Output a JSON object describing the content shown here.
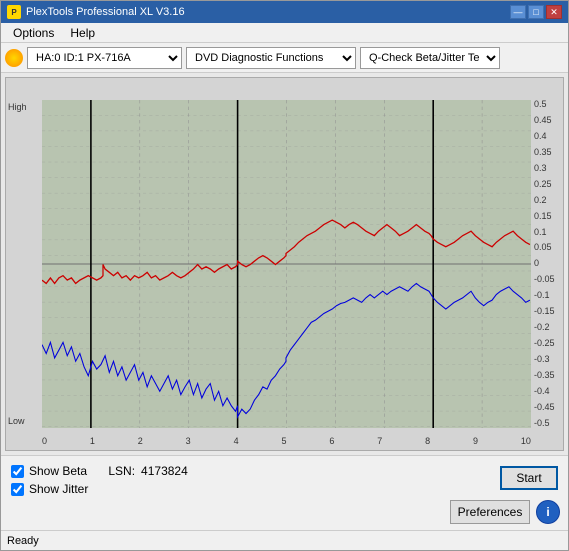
{
  "window": {
    "title": "PlexTools Professional XL V3.16",
    "icon": "P"
  },
  "titleButtons": {
    "minimize": "—",
    "maximize": "□",
    "close": "✕"
  },
  "menu": {
    "items": [
      "Options",
      "Help"
    ]
  },
  "toolbar": {
    "driveLabel": "HA:0 ID:1  PX-716A",
    "functionLabel": "DVD Diagnostic Functions",
    "testLabel": "Q-Check Beta/Jitter Test"
  },
  "chartLabels": {
    "high": "High",
    "low": "Low",
    "yLeftLabels": [],
    "yRightLabels": [
      "0.5",
      "0.45",
      "0.4",
      "0.35",
      "0.3",
      "0.25",
      "0.2",
      "0.15",
      "0.1",
      "0.05",
      "0",
      "-0.05",
      "-0.1",
      "-0.15",
      "-0.2",
      "-0.25",
      "-0.3",
      "-0.35",
      "-0.4",
      "-0.45",
      "-0.5"
    ],
    "xLabels": [
      "0",
      "1",
      "2",
      "3",
      "4",
      "5",
      "6",
      "7",
      "8",
      "9",
      "10"
    ]
  },
  "checkboxes": {
    "showBeta": {
      "label": "Show Beta",
      "checked": true
    },
    "showJitter": {
      "label": "Show Jitter",
      "checked": true
    }
  },
  "lsn": {
    "label": "LSN:",
    "value": "4173824"
  },
  "buttons": {
    "start": "Start",
    "preferences": "Preferences",
    "info": "i"
  },
  "statusBar": {
    "text": "Ready"
  }
}
